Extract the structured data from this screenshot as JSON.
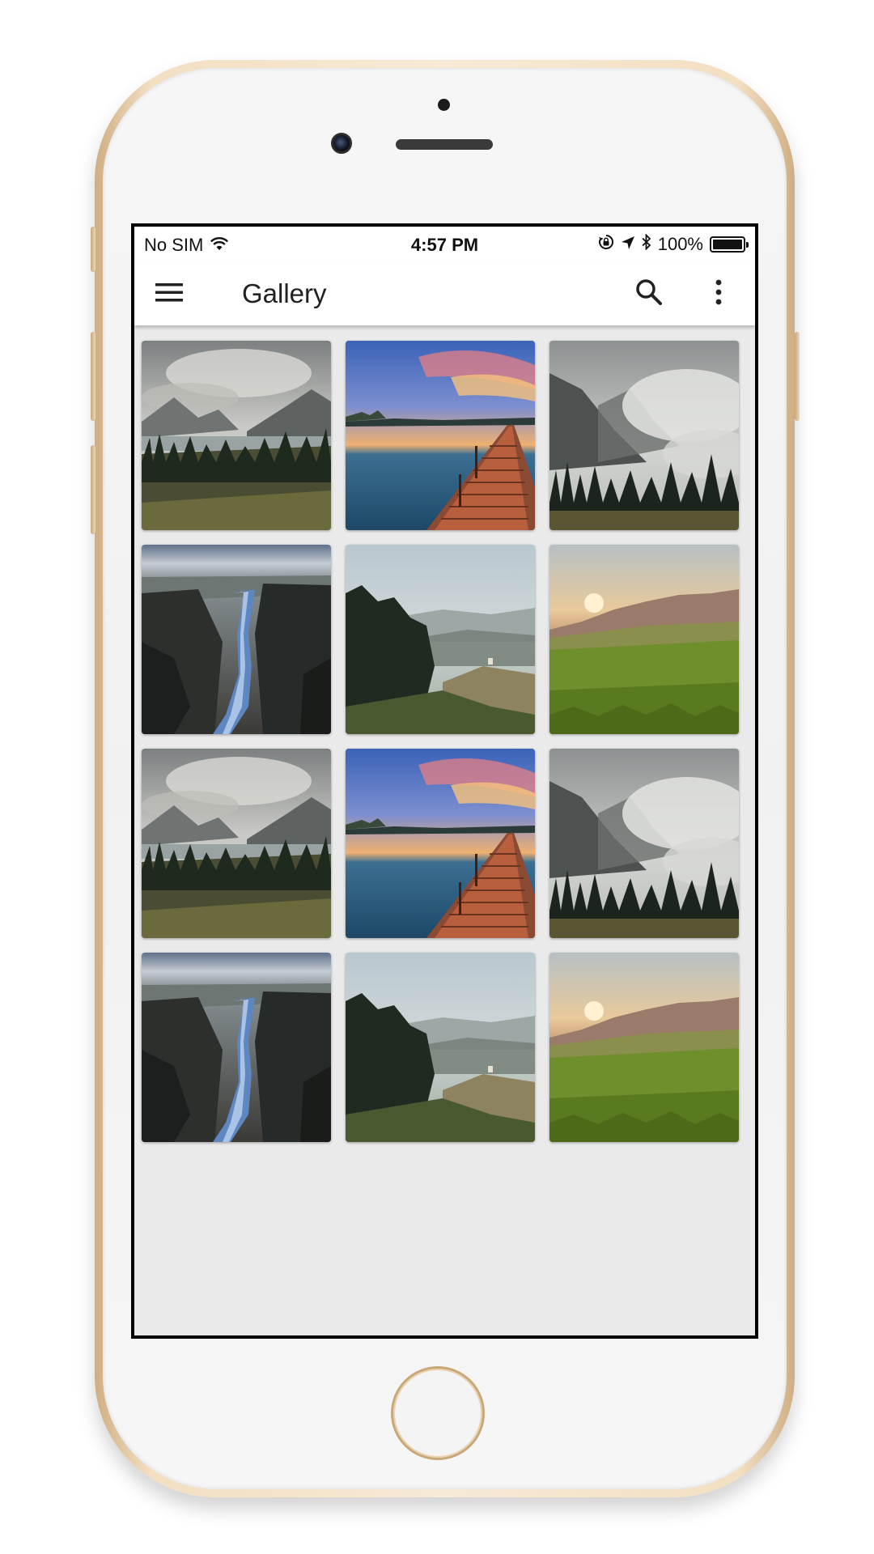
{
  "status_bar": {
    "carrier": "No SIM",
    "time": "4:57 PM",
    "battery_percent": "100%",
    "battery_level": 1.0,
    "icons": [
      "wifi-icon",
      "orientation-lock-icon",
      "location-arrow-icon",
      "bluetooth-icon",
      "battery-icon"
    ]
  },
  "app_bar": {
    "title": "Gallery",
    "icons": [
      "menu-icon",
      "search-icon",
      "more-vert-icon"
    ]
  },
  "gallery": {
    "photos": [
      {
        "scene": "cloudy-lake-valley"
      },
      {
        "scene": "sunset-pier-lake"
      },
      {
        "scene": "misty-mountain-forest"
      },
      {
        "scene": "river-canyon"
      },
      {
        "scene": "forest-hillside"
      },
      {
        "scene": "meadow-sunrise"
      },
      {
        "scene": "cloudy-lake-valley"
      },
      {
        "scene": "sunset-pier-lake"
      },
      {
        "scene": "misty-mountain-forest"
      },
      {
        "scene": "river-canyon"
      },
      {
        "scene": "forest-hillside"
      },
      {
        "scene": "meadow-sunrise"
      }
    ]
  },
  "colors": {
    "screen_background": "#eaeaea",
    "app_bar_background": "#ffffff",
    "title_text": "#212121",
    "phone_gold": "#e9d3b3"
  }
}
